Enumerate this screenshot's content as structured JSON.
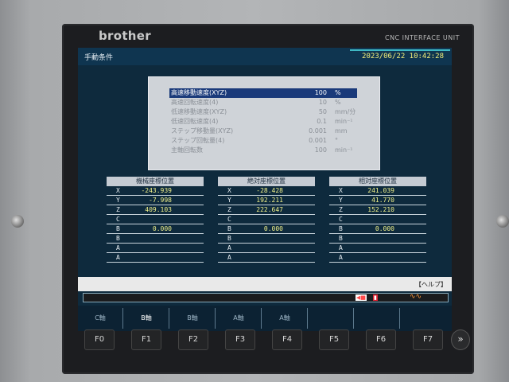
{
  "device": {
    "brand": "brother",
    "unit_label": "CNC INTERFACE UNIT"
  },
  "header": {
    "title": "手動条件",
    "datetime": "2023/06/22 10:42:28"
  },
  "conditions": [
    {
      "label": "高速移動速度(XYZ)",
      "value": "100",
      "unit": "%"
    },
    {
      "label": "高速回転速度(4)",
      "value": "10",
      "unit": "%"
    },
    {
      "label": "低速移動速度(XYZ)",
      "value": "50",
      "unit": "mm/分"
    },
    {
      "label": "低速回転速度(4)",
      "value": "0.1",
      "unit": "min⁻¹"
    },
    {
      "label": "ステップ移動量(XYZ)",
      "value": "0.001",
      "unit": "mm"
    },
    {
      "label": "ステップ回転量(4)",
      "value": "0.001",
      "unit": "°"
    },
    {
      "label": "主軸回転数",
      "value": "100",
      "unit": "min⁻¹"
    }
  ],
  "coords": [
    {
      "title": "機械座標位置",
      "rows": [
        {
          "axis": "X",
          "value": "-243.939"
        },
        {
          "axis": "Y",
          "value": "-7.998"
        },
        {
          "axis": "Z",
          "value": "409.103"
        },
        {
          "axis": "C",
          "value": ""
        },
        {
          "axis": "B",
          "value": "0.000"
        },
        {
          "axis": "B",
          "value": ""
        },
        {
          "axis": "A",
          "value": ""
        },
        {
          "axis": "A",
          "value": ""
        }
      ]
    },
    {
      "title": "絶対座標位置",
      "rows": [
        {
          "axis": "X",
          "value": "-28.428"
        },
        {
          "axis": "Y",
          "value": "192.211"
        },
        {
          "axis": "Z",
          "value": "222.647"
        },
        {
          "axis": "C",
          "value": ""
        },
        {
          "axis": "B",
          "value": "0.000"
        },
        {
          "axis": "B",
          "value": ""
        },
        {
          "axis": "A",
          "value": ""
        },
        {
          "axis": "A",
          "value": ""
        }
      ]
    },
    {
      "title": "相対座標位置",
      "rows": [
        {
          "axis": "X",
          "value": "241.039"
        },
        {
          "axis": "Y",
          "value": "41.770"
        },
        {
          "axis": "Z",
          "value": "152.210"
        },
        {
          "axis": "C",
          "value": ""
        },
        {
          "axis": "B",
          "value": "0.000"
        },
        {
          "axis": "B",
          "value": ""
        },
        {
          "axis": "A",
          "value": ""
        },
        {
          "axis": "A",
          "value": ""
        }
      ]
    }
  ],
  "help": {
    "label": "【ヘルプ】"
  },
  "softkeys": [
    "C軸",
    "B軸",
    "B軸",
    "A軸",
    "A軸",
    "",
    "",
    ""
  ],
  "fkeys": [
    "F0",
    "F1",
    "F2",
    "F3",
    "F4",
    "F5",
    "F6",
    "F7"
  ],
  "next_key": "»"
}
